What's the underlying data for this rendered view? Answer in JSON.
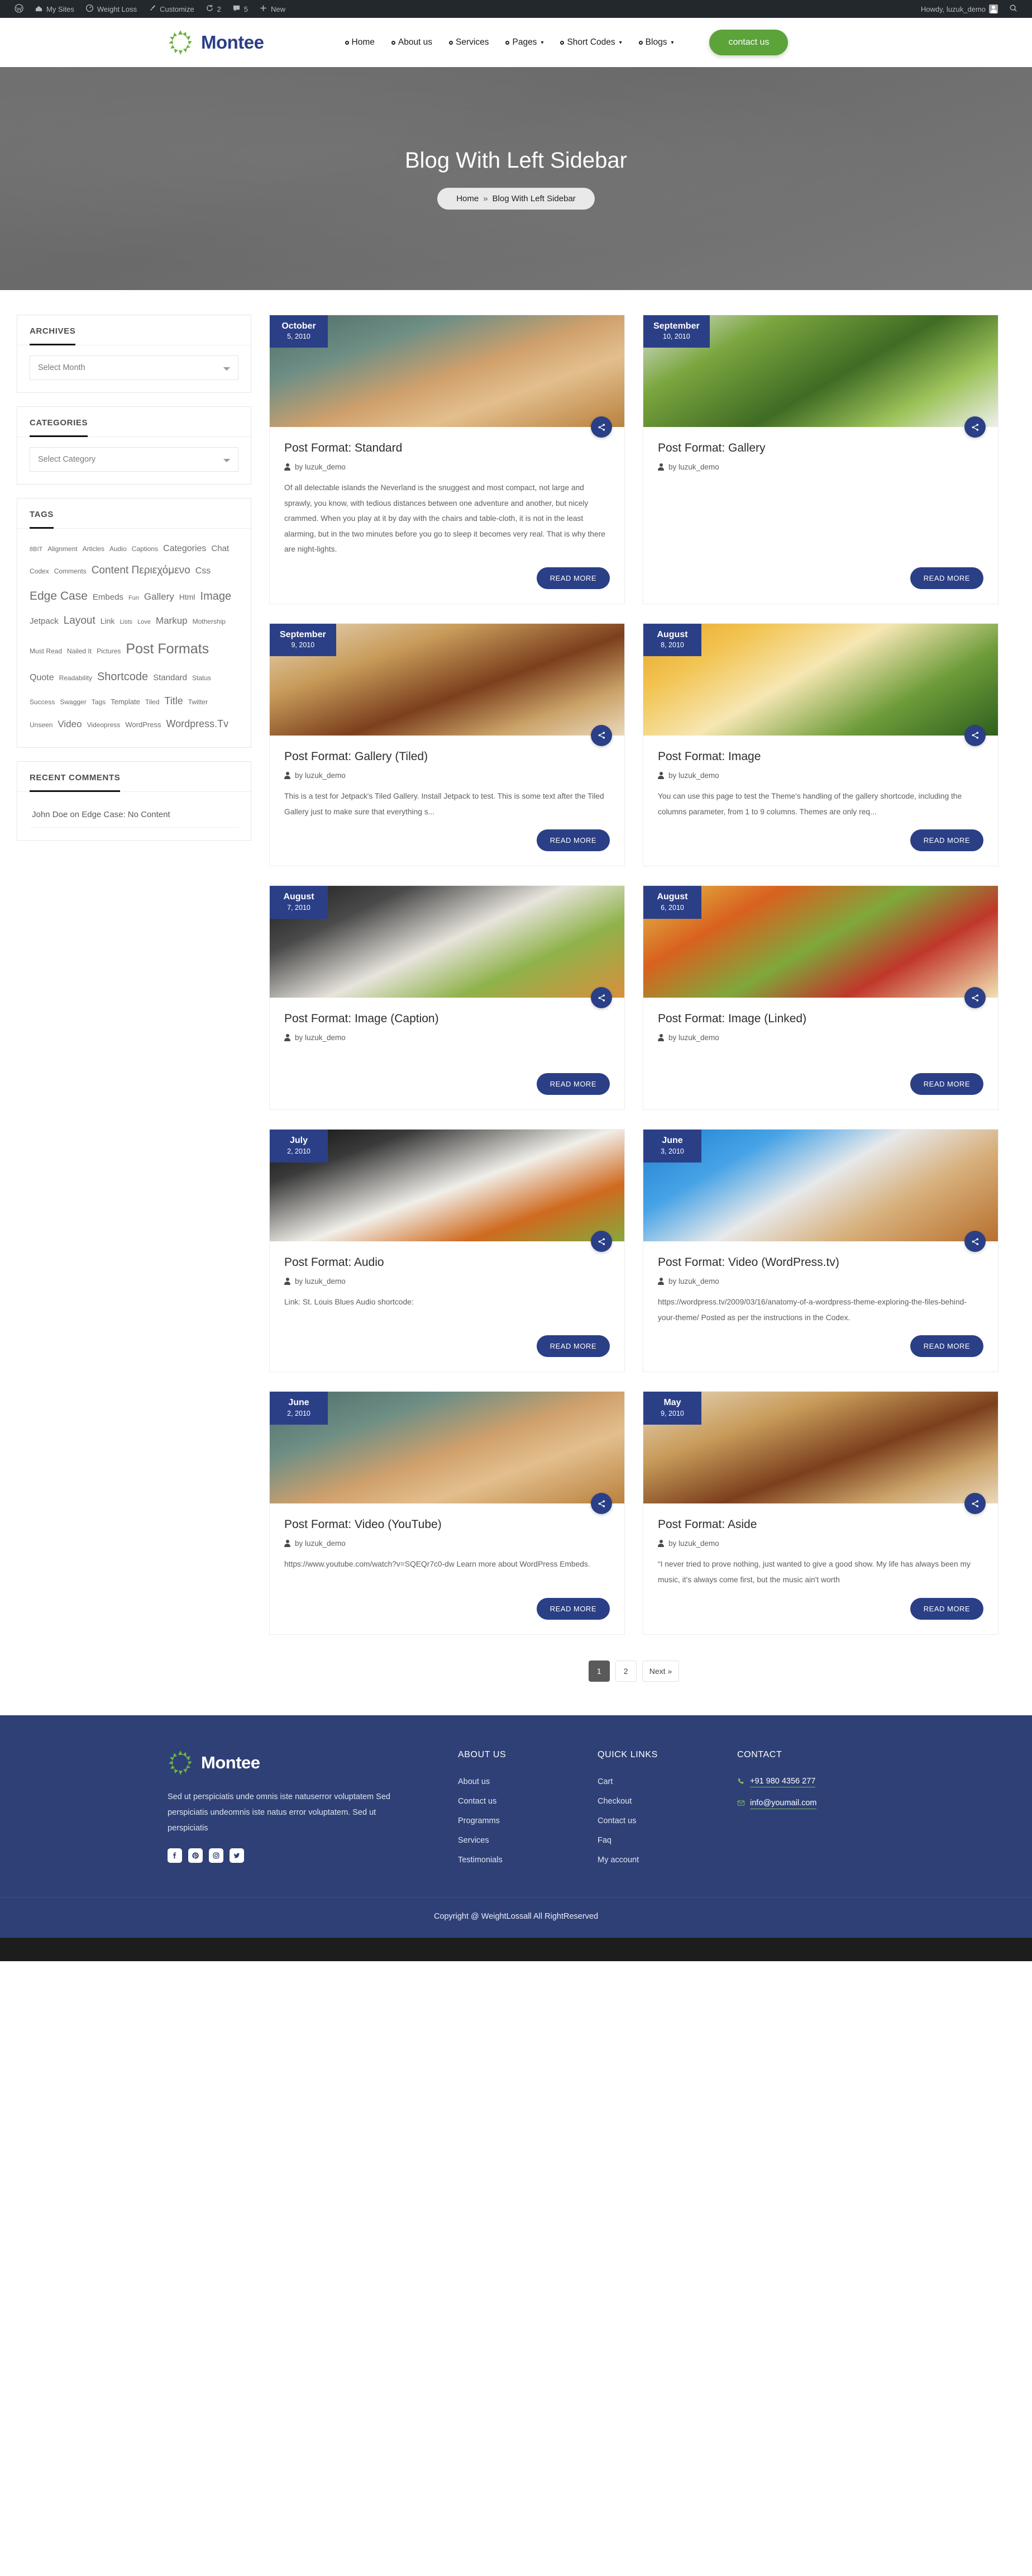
{
  "adminbar": {
    "items": [
      {
        "icon": "wordpress-icon",
        "label": ""
      },
      {
        "icon": "site-icon",
        "label": "My Sites"
      },
      {
        "icon": "dashboard-icon",
        "label": "Weight Loss"
      },
      {
        "icon": "brush-icon",
        "label": "Customize"
      },
      {
        "icon": "updates-icon",
        "label": "2"
      },
      {
        "icon": "comment-icon",
        "label": "5"
      },
      {
        "icon": "plus-icon",
        "label": "New"
      }
    ],
    "howdy": "Howdy, luzuk_demo",
    "search_icon": "search-icon"
  },
  "header": {
    "brand": "Montee",
    "nav": [
      {
        "label": "Home",
        "caret": false
      },
      {
        "label": "About us",
        "caret": false
      },
      {
        "label": "Services",
        "caret": false
      },
      {
        "label": "Pages",
        "caret": true
      },
      {
        "label": "Short Codes",
        "caret": true
      },
      {
        "label": "Blogs",
        "caret": true
      }
    ],
    "cta": "contact us"
  },
  "hero": {
    "title": "Blog With Left Sidebar",
    "breadcrumb_home": "Home",
    "breadcrumb_sep": "»",
    "breadcrumb_current": "Blog With Left Sidebar"
  },
  "sidebar": {
    "archives": {
      "title": "ARCHIVES",
      "select_value": "Select Month"
    },
    "categories": {
      "title": "CATEGORIES",
      "select_value": "Select Category"
    },
    "tags": {
      "title": "TAGS",
      "items": [
        {
          "label": "8BIT",
          "size": 11
        },
        {
          "label": "Alignment",
          "size": 12
        },
        {
          "label": "Articles",
          "size": 12
        },
        {
          "label": "Audio",
          "size": 12
        },
        {
          "label": "Captions",
          "size": 12
        },
        {
          "label": "Categories",
          "size": 16
        },
        {
          "label": "Chat",
          "size": 15
        },
        {
          "label": "Codex",
          "size": 12
        },
        {
          "label": "Comments",
          "size": 12
        },
        {
          "label": "Content Περιεχόμενο",
          "size": 19
        },
        {
          "label": "Css",
          "size": 16
        },
        {
          "label": "Edge Case",
          "size": 21
        },
        {
          "label": "Embeds",
          "size": 15
        },
        {
          "label": "Fun",
          "size": 11
        },
        {
          "label": "Gallery",
          "size": 17
        },
        {
          "label": "Html",
          "size": 14
        },
        {
          "label": "Image",
          "size": 20
        },
        {
          "label": "Jetpack",
          "size": 15
        },
        {
          "label": "Layout",
          "size": 19
        },
        {
          "label": "Link",
          "size": 14
        },
        {
          "label": "Lists",
          "size": 11
        },
        {
          "label": "Love",
          "size": 11
        },
        {
          "label": "Markup",
          "size": 17
        },
        {
          "label": "Mothership",
          "size": 12
        },
        {
          "label": "Must Read",
          "size": 12
        },
        {
          "label": "Nailed It",
          "size": 12
        },
        {
          "label": "Pictures",
          "size": 12
        },
        {
          "label": "Post Formats",
          "size": 25
        },
        {
          "label": "Quote",
          "size": 16
        },
        {
          "label": "Readability",
          "size": 12
        },
        {
          "label": "Shortcode",
          "size": 20
        },
        {
          "label": "Standard",
          "size": 15
        },
        {
          "label": "Status",
          "size": 12
        },
        {
          "label": "Success",
          "size": 12
        },
        {
          "label": "Swagger",
          "size": 12
        },
        {
          "label": "Tags",
          "size": 12
        },
        {
          "label": "Template",
          "size": 13
        },
        {
          "label": "Tiled",
          "size": 12
        },
        {
          "label": "Title",
          "size": 18
        },
        {
          "label": "Twitter",
          "size": 12
        },
        {
          "label": "Unseen",
          "size": 12
        },
        {
          "label": "Video",
          "size": 17
        },
        {
          "label": "Videopress",
          "size": 12
        },
        {
          "label": "WordPress",
          "size": 13
        },
        {
          "label": "Wordpress.Tv",
          "size": 18
        }
      ]
    },
    "recent_comments": {
      "title": "RECENT COMMENTS",
      "items": [
        "John Doe on Edge Case: No Content"
      ]
    }
  },
  "posts": [
    {
      "month": "October",
      "day": "5, 2010",
      "title": "Post Format: Standard",
      "author": "by luzuk_demo",
      "excerpt": "Of all delectable islands the Neverland is the snuggest and most compact, not large and sprawly, you know, with tedious distances between one adventure and another, but nicely crammed. When you play at it by day with the chairs and table-cloth, it is not in the least alarming, but in the two minutes before you go to sleep it becomes very real. That is why there are night-lights.",
      "read_more": "READ MORE",
      "img": "sandwich-caliper"
    },
    {
      "month": "September",
      "day": "10, 2010",
      "title": "Post Format: Gallery",
      "author": "by luzuk_demo",
      "excerpt": "",
      "read_more": "READ MORE",
      "img": "broccoli-bowl"
    },
    {
      "month": "September",
      "day": "9, 2010",
      "title": "Post Format: Gallery (Tiled)",
      "author": "by luzuk_demo",
      "excerpt": "This is a test for Jetpack's Tiled Gallery. Install Jetpack to test. This is some text after the Tiled Gallery just to make sure that everything s...",
      "read_more": "READ MORE",
      "img": "tea-bread"
    },
    {
      "month": "August",
      "day": "8, 2010",
      "title": "Post Format: Image",
      "author": "by luzuk_demo",
      "excerpt": "You can use this page to test the Theme's handling of the gallery shortcode, including the columns parameter, from 1 to 9 columns. Themes are only req...",
      "read_more": "READ MORE",
      "img": "juice-fruit"
    },
    {
      "month": "August",
      "day": "7, 2010",
      "title": "Post Format: Image (Caption)",
      "author": "by luzuk_demo",
      "excerpt": "",
      "read_more": "READ MORE",
      "img": "veg-plate-tape"
    },
    {
      "month": "August",
      "day": "6, 2010",
      "title": "Post Format: Image (Linked)",
      "author": "by luzuk_demo",
      "excerpt": "",
      "read_more": "READ MORE",
      "img": "salad-plate"
    },
    {
      "month": "July",
      "day": "2, 2010",
      "title": "Post Format: Audio",
      "author": "by luzuk_demo",
      "excerpt": "Link: St. Louis Blues Audio shortcode:",
      "read_more": "READ MORE",
      "img": "veg-plate-dark"
    },
    {
      "month": "June",
      "day": "3, 2010",
      "title": "Post Format: Video (WordPress.tv)",
      "author": "by luzuk_demo",
      "excerpt": "https://wordpress.tv/2009/03/16/anatomy-of-a-wordpress-theme-exploring-the-files-behind-your-theme/ Posted as per the instructions in the Codex.",
      "read_more": "READ MORE",
      "img": "sandwich-tape"
    },
    {
      "month": "June",
      "day": "2, 2010",
      "title": "Post Format: Video (YouTube)",
      "author": "by luzuk_demo",
      "excerpt": "https://www.youtube.com/watch?v=SQEQr7c0-dw Learn more about WordPress Embeds.",
      "read_more": "READ MORE",
      "img": "sandwich-caliper"
    },
    {
      "month": "May",
      "day": "9, 2010",
      "title": "Post Format: Aside",
      "author": "by luzuk_demo",
      "excerpt": "“I never tried to prove nothing, just wanted to give a good show. My life has always been my music, it's always come first, but the music ain't worth",
      "read_more": "READ MORE",
      "img": "tea-bread"
    }
  ],
  "pagination": {
    "pages": [
      "1",
      "2"
    ],
    "current": "1",
    "next": "Next »"
  },
  "footer": {
    "brand": "Montee",
    "about": "Sed ut perspiciatis unde omnis iste natuserror voluptatem Sed perspiciatis undeomnis iste natus error voluptatem. Sed ut perspiciatis",
    "socials": [
      "facebook-icon",
      "pinterest-icon",
      "instagram-icon",
      "twitter-icon"
    ],
    "columns": [
      {
        "title": "ABOUT US",
        "links": [
          "About us",
          "Contact us",
          "Programms",
          "Services",
          "Testimonials"
        ]
      },
      {
        "title": "QUICK LINKS",
        "links": [
          "Cart",
          "Checkout",
          "Contact us",
          "Faq",
          "My account"
        ]
      }
    ],
    "contact": {
      "title": "CONTACT",
      "phone": "+91 980 4356 277",
      "email": "info@youmail.com"
    },
    "copyright": "Copyright @ WeightLossall All RightReserved"
  },
  "colors": {
    "brand_blue": "#2b3f87",
    "footer_blue": "#2e4076",
    "accent_green": "#5ca33a",
    "adminbar": "#23282d"
  }
}
